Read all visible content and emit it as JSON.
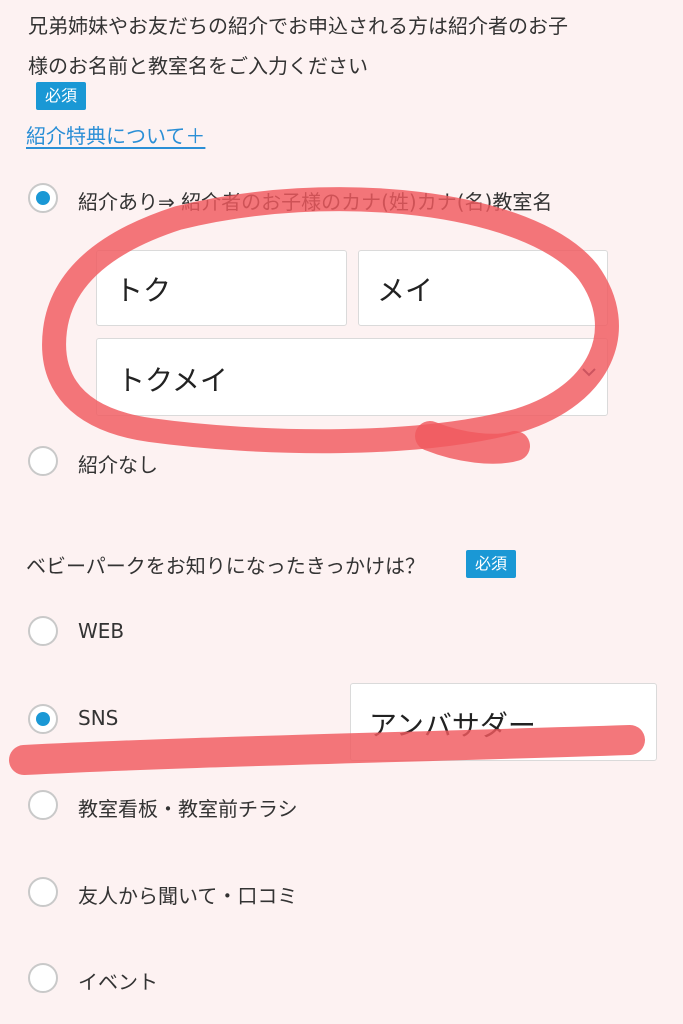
{
  "intro": {
    "line1": "兄弟姉妹やお友だちの紹介でお申込される方は紹介者のお子",
    "line2": "様のお名前と教室名をご入力ください",
    "required_badge": "必須"
  },
  "referral_link": "紹介特典について＋",
  "referral": {
    "option_yes_label": "紹介あり⇒ 紹介者のお子様のカナ(姓)カナ(名)教室名",
    "option_yes_checked": true,
    "surname_kana": "トク",
    "given_kana": "メイ",
    "classroom_select": "トクメイ",
    "option_no_label": "紹介なし",
    "option_no_checked": false
  },
  "source_question": {
    "label": "ベビーパークをお知りになったきっかけは？",
    "required_badge": "必須",
    "options": [
      {
        "label": "WEB",
        "checked": false
      },
      {
        "label": "SNS",
        "checked": true
      },
      {
        "label": "教室看板・教室前チラシ",
        "checked": false
      },
      {
        "label": "友人から聞いて・口コミ",
        "checked": false
      },
      {
        "label": "イベント",
        "checked": false
      }
    ],
    "sns_detail_value": "アンバサダー"
  },
  "colors": {
    "accent": "#1a98d5",
    "background": "#fdf2f2",
    "highlighter": "#f0595e"
  },
  "icons": {
    "select_arrow": "chevron-down-icon"
  }
}
